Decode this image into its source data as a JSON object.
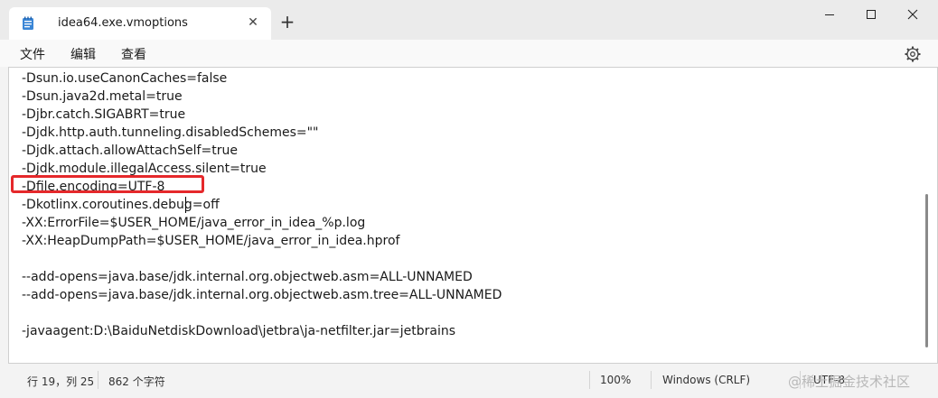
{
  "tab": {
    "title": "idea64.exe.vmoptions",
    "close_icon": "close-icon",
    "file_icon": "notepad-icon",
    "new_tab_symbol": "+"
  },
  "window": {
    "minimize_icon": "minimize-icon",
    "maximize_icon": "maximize-icon",
    "close_icon": "window-close-icon"
  },
  "menu": {
    "file": "文件",
    "edit": "编辑",
    "view": "查看",
    "settings_icon": "gear-icon"
  },
  "editor": {
    "lines": [
      "-Dsun.io.useCanonCaches=false",
      "-Dsun.java2d.metal=true",
      "-Djbr.catch.SIGABRT=true",
      "-Djdk.http.auth.tunneling.disabledSchemes=\"\"",
      "-Djdk.attach.allowAttachSelf=true",
      "-Djdk.module.illegalAccess.silent=true",
      "-Dfile.encoding=UTF-8",
      "-Dkotlinx.coroutines.debug=off",
      "-XX:ErrorFile=$USER_HOME/java_error_in_idea_%p.log",
      "-XX:HeapDumpPath=$USER_HOME/java_error_in_idea.hprof",
      "",
      "--add-opens=java.base/jdk.internal.org.objectweb.asm=ALL-UNNAMED",
      "--add-opens=java.base/jdk.internal.org.objectweb.asm.tree=ALL-UNNAMED",
      "",
      "-javaagent:D:\\BaiduNetdiskDownload\\jetbra\\ja-netfilter.jar=jetbrains"
    ],
    "highlight_color": "#e5282b"
  },
  "status": {
    "position": "行 19，列 25",
    "char_count": "862 个字符",
    "zoom": "100%",
    "line_ending": "Windows (CRLF)",
    "encoding": "UTF-8"
  },
  "watermark": "@稀土掘金技术社区"
}
